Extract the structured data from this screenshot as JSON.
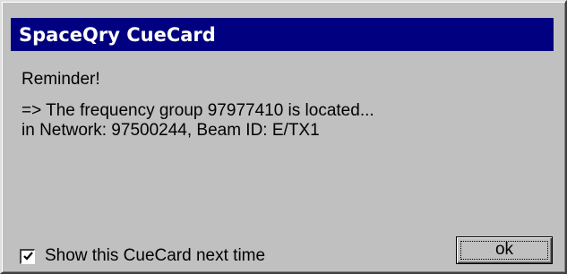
{
  "window": {
    "title": "SpaceQry CueCard"
  },
  "message": {
    "heading": "Reminder!",
    "line1": "=>  The frequency group  97977410 is located...",
    "line2": "in Network: 97500244,  Beam ID:  E/TX1"
  },
  "footer": {
    "checkbox_label": "Show this CueCard next time",
    "checkbox_checked": true,
    "ok_label": "ok"
  },
  "colors": {
    "title_bar": "#000080",
    "face": "#c0c0c0"
  },
  "icons": {
    "checkmark": "checkmark-icon"
  }
}
